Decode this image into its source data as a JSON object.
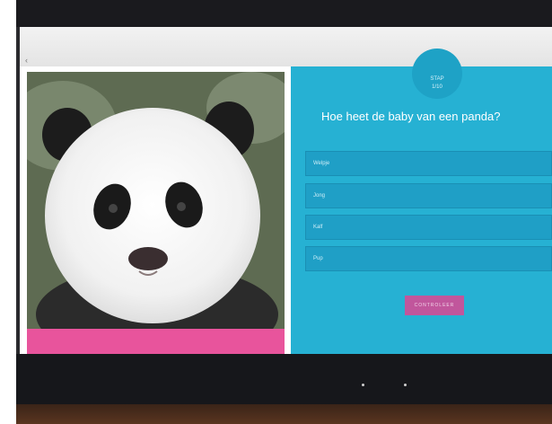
{
  "window": {
    "back_symbol": "‹"
  },
  "badge": {
    "line1": "STAP",
    "line2": "1/10"
  },
  "quiz": {
    "question": "Hoe heet de baby van een panda?",
    "answers": [
      {
        "label": "Welpje"
      },
      {
        "label": "Jong"
      },
      {
        "label": "Kalf"
      },
      {
        "label": "Pup"
      }
    ],
    "check_label": "CONTROLEER"
  },
  "colors": {
    "quiz_bg": "#26b1d3",
    "answer_bg": "#1f9fc6",
    "check_button": "#c1569c",
    "photo_strip": "#e8549c"
  }
}
